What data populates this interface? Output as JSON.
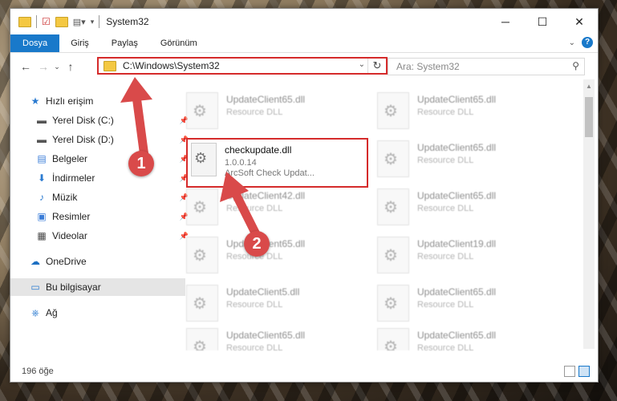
{
  "window": {
    "title": "System32"
  },
  "ribbon": {
    "tabs": [
      "Dosya",
      "Giriş",
      "Paylaş",
      "Görünüm"
    ]
  },
  "address": {
    "path": "C:\\Windows\\System32"
  },
  "search": {
    "placeholder": "Ara: System32"
  },
  "sidebar": {
    "items": [
      {
        "label": "Hızlı erişim",
        "icon": "star-icon"
      },
      {
        "label": "Yerel Disk (C:)",
        "icon": "drive-icon",
        "pinned": true
      },
      {
        "label": "Yerel Disk (D:)",
        "icon": "drive-icon",
        "pinned": true
      },
      {
        "label": "Belgeler",
        "icon": "documents-icon",
        "pinned": true
      },
      {
        "label": "İndirmeler",
        "icon": "download-icon",
        "pinned": true
      },
      {
        "label": "Müzik",
        "icon": "music-icon",
        "pinned": true
      },
      {
        "label": "Resimler",
        "icon": "pictures-icon",
        "pinned": true
      },
      {
        "label": "Videolar",
        "icon": "video-icon",
        "pinned": true
      },
      {
        "label": "OneDrive",
        "icon": "cloud-icon"
      },
      {
        "label": "Bu bilgisayar",
        "icon": "computer-icon",
        "selected": true
      },
      {
        "label": "Ağ",
        "icon": "network-icon"
      }
    ]
  },
  "files": [
    {
      "name": "UpdateClient65.dll",
      "sub": "Resource DLL"
    },
    {
      "name": "UpdateClient65.dll",
      "sub": "Resource DLL"
    },
    {
      "name": "checkupdate.dll",
      "sub": "1.0.0.14",
      "sub2": "ArcSoft Check Updat..."
    },
    {
      "name": "UpdateClient65.dll",
      "sub": "Resource DLL"
    },
    {
      "name": "UpdateClient42.dll",
      "sub": "Resource DLL"
    },
    {
      "name": "UpdateClient65.dll",
      "sub": "Resource DLL"
    },
    {
      "name": "UpdateClient65.dll",
      "sub": "Resource DLL"
    },
    {
      "name": "UpdateClient19.dll",
      "sub": "Resource DLL"
    },
    {
      "name": "UpdateClient5.dll",
      "sub": "Resource DLL"
    },
    {
      "name": "UpdateClient65.dll",
      "sub": "Resource DLL"
    },
    {
      "name": "UpdateClient65.dll",
      "sub": "Resource DLL"
    },
    {
      "name": "UpdateClient65.dll",
      "sub": "Resource DLL"
    }
  ],
  "status": {
    "count": "196 öğe"
  },
  "annotations": {
    "step1": "1",
    "step2": "2"
  },
  "colors": {
    "accent": "#1979ca",
    "highlight": "#d52b2b",
    "badge": "#d94a4a"
  }
}
